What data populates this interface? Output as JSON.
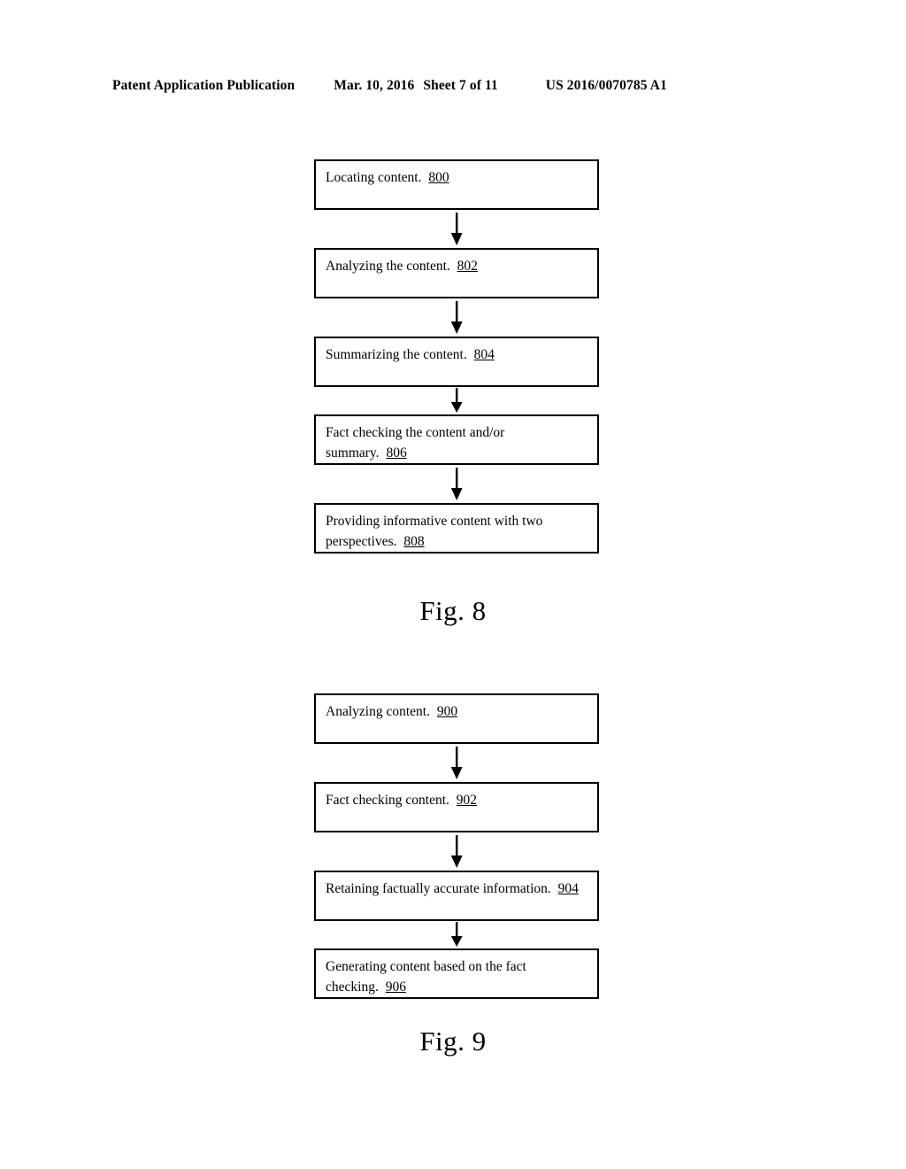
{
  "header": {
    "publication": "Patent Application Publication",
    "date": "Mar. 10, 2016",
    "sheet": "Sheet 7 of 11",
    "patent_number": "US 2016/0070785 A1"
  },
  "figures": [
    {
      "id": "figure-8",
      "caption": "Fig. 8",
      "steps": [
        {
          "text": "Locating content.",
          "ref": "800"
        },
        {
          "text": "Analyzing the content.",
          "ref": "802"
        },
        {
          "text": "Summarizing the content.",
          "ref": "804"
        },
        {
          "text": "Fact checking the content and/or\nsummary.",
          "ref": "806"
        },
        {
          "text": "Providing informative content with two\nperspectives.",
          "ref": "808"
        }
      ]
    },
    {
      "id": "figure-9",
      "caption": "Fig. 9",
      "steps": [
        {
          "text": "Analyzing content.",
          "ref": "900"
        },
        {
          "text": "Fact checking content.",
          "ref": "902"
        },
        {
          "text": "Retaining factually accurate information.",
          "ref": "904"
        },
        {
          "text": "Generating content based on the fact\nchecking.",
          "ref": "906"
        }
      ]
    }
  ],
  "colors": {
    "ink": "#000000",
    "paper": "#ffffff"
  }
}
